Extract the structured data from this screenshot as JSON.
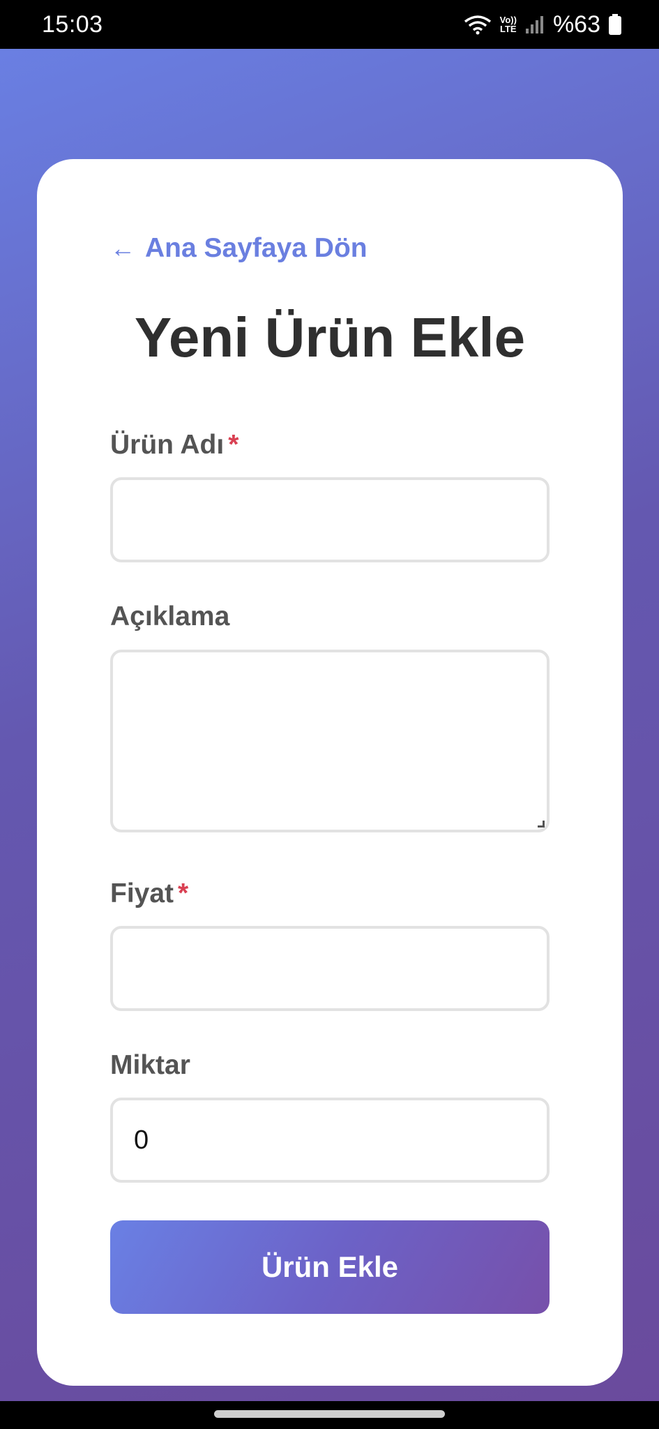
{
  "status_bar": {
    "time": "15:03",
    "lte_top": "Vo))",
    "lte_bottom": "LTE",
    "battery_percent": "%63"
  },
  "back_link": {
    "arrow": "←",
    "label": "Ana Sayfaya Dön"
  },
  "page_title": "Yeni Ürün Ekle",
  "form": {
    "name": {
      "label": "Ürün Adı",
      "required_mark": "*",
      "value": ""
    },
    "description": {
      "label": "Açıklama",
      "value": ""
    },
    "price": {
      "label": "Fiyat",
      "required_mark": "*",
      "value": ""
    },
    "quantity": {
      "label": "Miktar",
      "value": "0"
    },
    "submit_label": "Ürün Ekle"
  },
  "colors": {
    "accent": "#6a7fe0",
    "required": "#d94052",
    "title": "#2f2f2f",
    "label": "#545454"
  }
}
